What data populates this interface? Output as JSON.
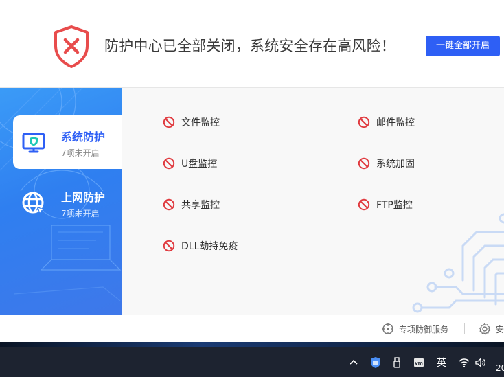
{
  "header": {
    "warning": "防护中心已全部关闭，系统安全存在高风险！",
    "enable_all_button": "一键全部开启",
    "status_color": "#e84c4c",
    "accent_color": "#2e5ff5"
  },
  "sidebar": {
    "items": [
      {
        "title": "系统防护",
        "subtitle": "7项未开启",
        "icon": "monitor-shield-icon",
        "active": true
      },
      {
        "title": "上网防护",
        "subtitle": "7项未开启",
        "icon": "globe-icon",
        "active": false
      }
    ]
  },
  "features": [
    {
      "label": "文件监控",
      "status": "off"
    },
    {
      "label": "邮件监控",
      "status": "off"
    },
    {
      "label": "U盘监控",
      "status": "off"
    },
    {
      "label": "系统加固",
      "status": "off"
    },
    {
      "label": "共享监控",
      "status": "off"
    },
    {
      "label": "FTP监控",
      "status": "off"
    },
    {
      "label": "DLL劫持免疫",
      "status": "off"
    }
  ],
  "footer": {
    "special_service": "专项防御服务",
    "settings_partial": "安"
  },
  "taskbar": {
    "ime": "英",
    "clock_partial": "20"
  }
}
